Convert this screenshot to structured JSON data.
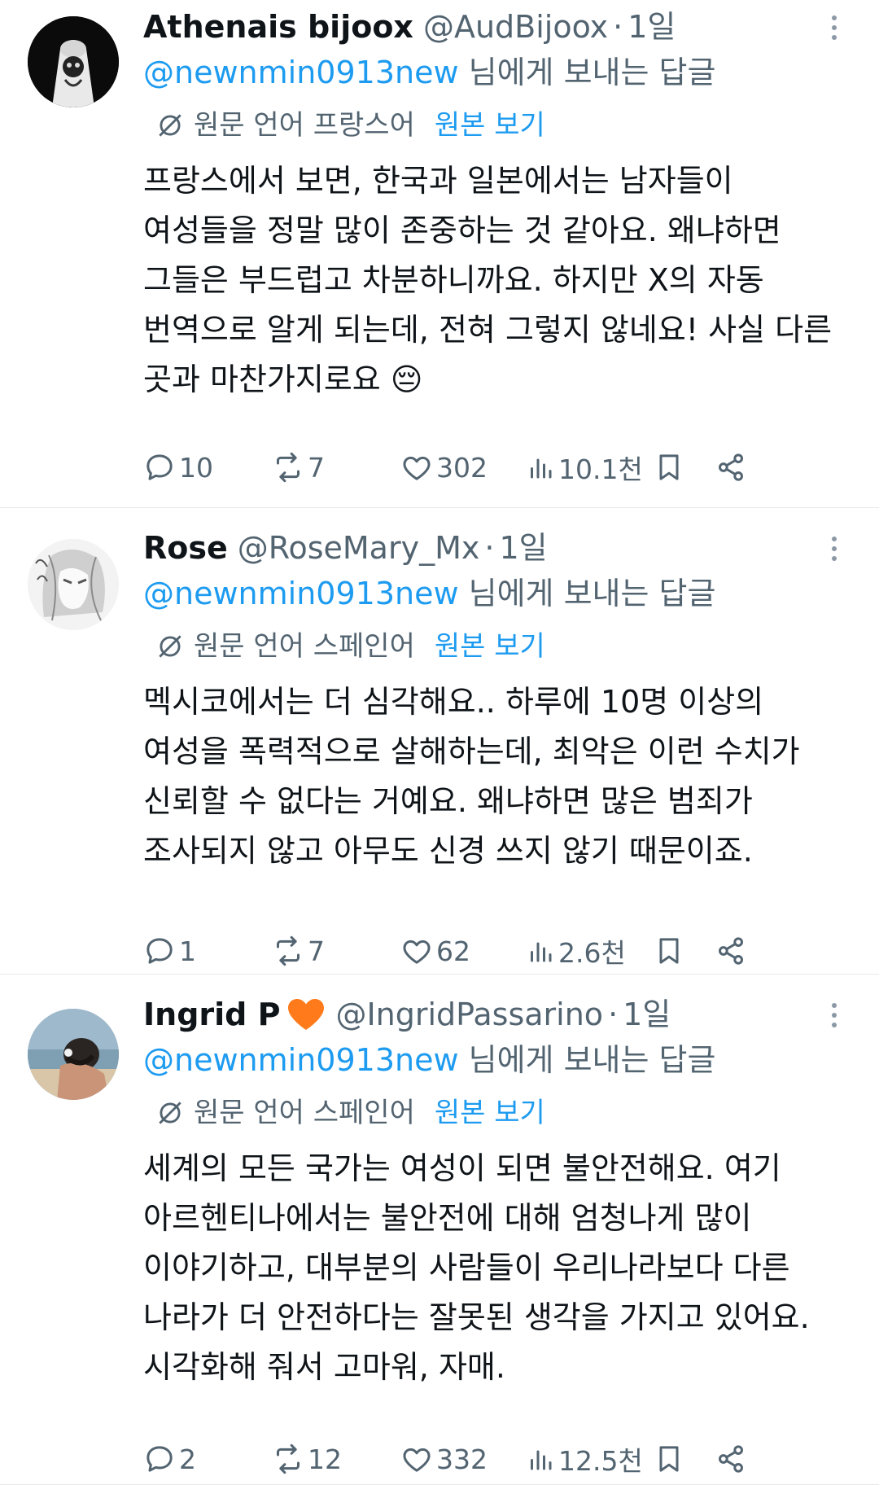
{
  "tweets": [
    {
      "name": "Athenais bijoox",
      "handle": "@AudBijoox",
      "time": "1일",
      "reply_mention": "@newnmin0913new",
      "reply_suffix": " 님에게 보내는 답글",
      "translation_label": "원문 언어 프랑스어",
      "show_original": "원본 보기",
      "text": "프랑스에서 보면, 한국과 일본에서는 남자들이\n여성들을 정말 많이 존중하는 것 같아요. 왜냐하면\n그들은 부드럽고 차분하니까요. 하지만 X의 자동\n번역으로 알게 되는데, 전혀 그렇지 않네요! 사실 다른\n곳과 마찬가지로요 😔",
      "replies": "10",
      "reposts": "7",
      "likes": "302",
      "views": "10.1천"
    },
    {
      "name": "Rose",
      "handle": "@RoseMary_Mx",
      "time": "1일",
      "reply_mention": "@newnmin0913new",
      "reply_suffix": " 님에게 보내는 답글",
      "translation_label": "원문 언어 스페인어",
      "show_original": "원본 보기",
      "text": "멕시코에서는 더 심각해요.. 하루에 10명 이상의\n여성을 폭력적으로 살해하는데, 최악은 이런 수치가\n신뢰할 수 없다는 거예요. 왜냐하면 많은 범죄가\n조사되지 않고 아무도 신경 쓰지 않기 때문이죠.",
      "replies": "1",
      "reposts": "7",
      "likes": "62",
      "views": "2.6천"
    },
    {
      "name": "Ingrid P",
      "handle": "@IngridPassarino",
      "time": "1일",
      "reply_mention": "@newnmin0913new",
      "reply_suffix": " 님에게 보내는 답글",
      "translation_label": "원문 언어 스페인어",
      "show_original": "원본 보기",
      "text": "세계의 모든 국가는 여성이 되면 불안전해요. 여기\n아르헨티나에서는 불안전에 대해 엄청나게 많이\n이야기하고, 대부분의 사람들이 우리나라보다 다른\n나라가 더 안전하다는 잘못된 생각을 가지고 있어요.\n시각화해 줘서 고마워, 자매.",
      "replies": "2",
      "reposts": "12",
      "likes": "332",
      "views": "12.5천"
    }
  ],
  "colors": {
    "accent": "#1d9bf0",
    "secondary_text": "#536471",
    "primary_text": "#0f1419",
    "heart_emoji": "#ff7a1a"
  },
  "icons": [
    "reply-icon",
    "repost-icon",
    "like-icon",
    "views-icon",
    "bookmark-icon",
    "share-icon",
    "more-icon",
    "translate-icon",
    "orange-heart-icon"
  ]
}
